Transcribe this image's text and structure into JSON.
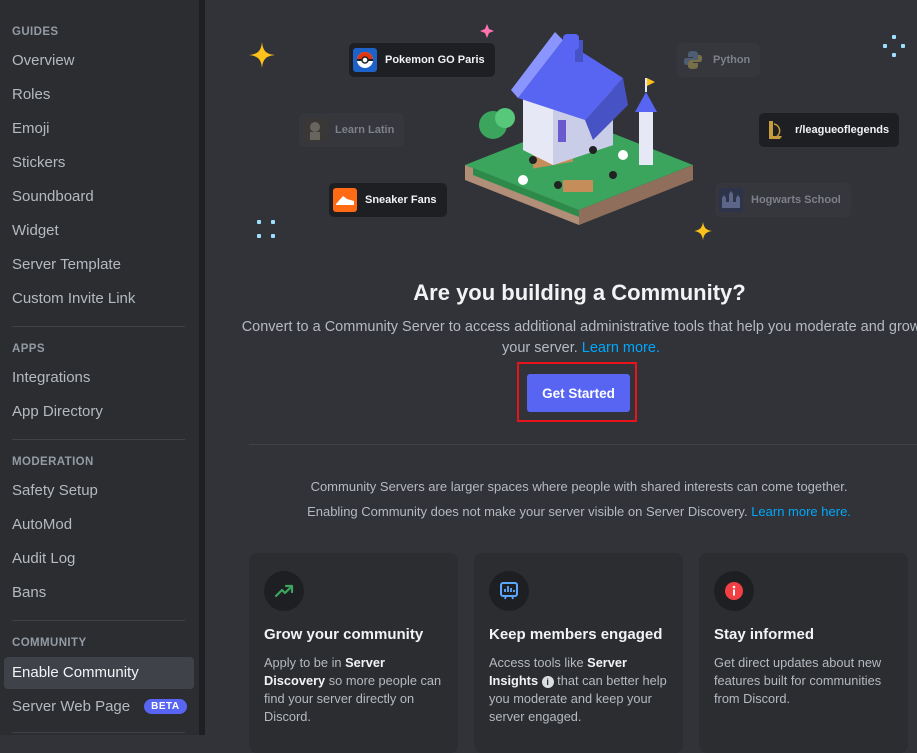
{
  "sidebar": {
    "sections": [
      {
        "header": "GUIDES",
        "items": [
          "Overview",
          "Roles",
          "Emoji",
          "Stickers",
          "Soundboard",
          "Widget",
          "Server Template",
          "Custom Invite Link"
        ]
      },
      {
        "header": "APPS",
        "items": [
          "Integrations",
          "App Directory"
        ]
      },
      {
        "header": "MODERATION",
        "items": [
          "Safety Setup",
          "AutoMod",
          "Audit Log",
          "Bans"
        ]
      },
      {
        "header": "COMMUNITY",
        "items": [
          "Enable Community",
          "Server Web Page"
        ]
      }
    ],
    "active_item": "Enable Community",
    "beta_badge": "BETA"
  },
  "hero": {
    "pills": [
      {
        "label": "Pokemon GO Paris",
        "icon": "pokeball-icon"
      },
      {
        "label": "Python",
        "icon": "python-icon"
      },
      {
        "label": "Learn Latin",
        "icon": "statue-icon"
      },
      {
        "label": "r/leagueoflegends",
        "icon": "league-icon"
      },
      {
        "label": "Sneaker Fans",
        "icon": "sneaker-icon"
      },
      {
        "label": "Hogwarts School",
        "icon": "castle-icon"
      }
    ]
  },
  "main": {
    "title": "Are you building a Community?",
    "subtitle": "Convert to a Community Server to access additional administrative tools that help you moderate and grow your server.",
    "learn_more": "Learn more.",
    "cta": "Get Started",
    "info_line1": "Community Servers are larger spaces where people with shared interests can come together.",
    "info_line2": "Enabling Community does not make your server visible on Server Discovery.",
    "info_link": "Learn more here."
  },
  "cards": [
    {
      "title": "Grow your community",
      "body_a": "Apply to be in ",
      "bold_a": "Server Discovery",
      "body_b": " so more people can find your server directly on Discord.",
      "icon": "trending-up-icon"
    },
    {
      "title": "Keep members engaged",
      "body_a": "Access tools like ",
      "bold_a": "Server Insights",
      "body_b": " that can better help you moderate and keep your server engaged.",
      "icon": "insights-icon"
    },
    {
      "title": "Stay informed",
      "body_a": "Get direct updates about new features built for communities from Discord.",
      "icon": "info-icon"
    }
  ],
  "colors": {
    "accent": "#5865f2",
    "link": "#00a8fc",
    "highlight": "#e8141b"
  }
}
